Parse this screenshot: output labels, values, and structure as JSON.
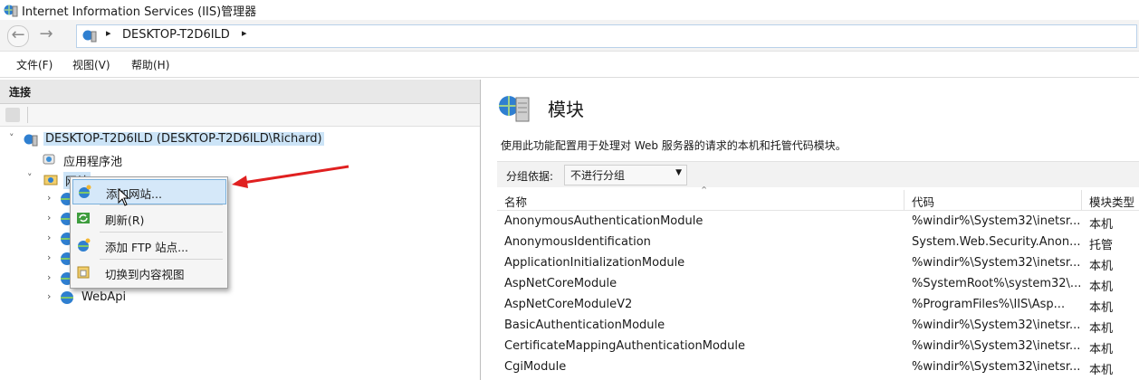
{
  "window": {
    "title": "Internet Information Services (IIS)管理器"
  },
  "nav": {
    "address": "DESKTOP-T2D6ILD",
    "back": "←",
    "forward": "→",
    "separator": "▸"
  },
  "menu": {
    "file": "文件(F)",
    "view": "视图(V)",
    "help": "帮助(H)"
  },
  "connections": {
    "header": "连接",
    "tree": {
      "root": "DESKTOP-T2D6ILD (DESKTOP-T2D6ILD\\Richard)",
      "app_pools": "应用程序池",
      "sites": "网站",
      "webapi": "WebApi"
    }
  },
  "context_menu": {
    "add_site": "添加网站...",
    "refresh": "刷新(R)",
    "add_ftp": "添加 FTP 站点...",
    "switch_view": "切换到内容视图"
  },
  "modules": {
    "title": "模块",
    "description": "使用此功能配置用于处理对 Web 服务器的请求的本机和托管代码模块。",
    "group_by_label": "分组依据:",
    "group_by_value": "不进行分组",
    "columns": {
      "name": "名称",
      "code": "代码",
      "type": "模块类型"
    },
    "rows": [
      {
        "name": "AnonymousAuthenticationModule",
        "code": "%windir%\\System32\\inetsr...",
        "type": "本机"
      },
      {
        "name": "AnonymousIdentification",
        "code": "System.Web.Security.Anon...",
        "type": "托管"
      },
      {
        "name": "ApplicationInitializationModule",
        "code": "%windir%\\System32\\inetsr...",
        "type": "本机"
      },
      {
        "name": "AspNetCoreModule",
        "code": "%SystemRoot%\\system32\\...",
        "type": "本机"
      },
      {
        "name": "AspNetCoreModuleV2",
        "code": "%ProgramFiles%\\IIS\\Asp...",
        "type": "本机"
      },
      {
        "name": "BasicAuthenticationModule",
        "code": "%windir%\\System32\\inetsr...",
        "type": "本机"
      },
      {
        "name": "CertificateMappingAuthenticationModule",
        "code": "%windir%\\System32\\inetsr...",
        "type": "本机"
      },
      {
        "name": "CgiModule",
        "code": "%windir%\\System32\\inetsr...",
        "type": "本机"
      }
    ]
  },
  "colors": {
    "accent_highlight": "#cce4f7",
    "menu_highlight": "#d5e8f9",
    "arrow": "#e02020"
  }
}
